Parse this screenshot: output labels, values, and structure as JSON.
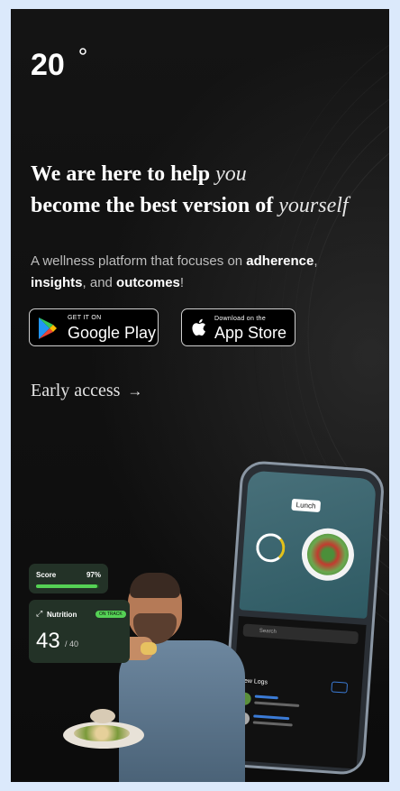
{
  "brand": {
    "logo_text": "20"
  },
  "hero": {
    "line1_bold": "We are here to help ",
    "line1_italic": "you",
    "line2_bold": "become the best version of ",
    "line2_italic": "yourself"
  },
  "subtitle": {
    "part1": "A wellness platform that focuses on ",
    "bold1": "adherence",
    "part2": ", ",
    "bold2": "insights",
    "part3": ", and ",
    "bold3": "outcomes",
    "part4": "!"
  },
  "stores": {
    "google_small": "GET IT ON",
    "google_big": "Google Play",
    "apple_small": "Download on the",
    "apple_big": "App Store"
  },
  "cta": {
    "early_access": "Early access",
    "arrow": "→"
  },
  "phone": {
    "lunch_tag": "Lunch",
    "search_placeholder": "Search",
    "new_logs": "New Logs"
  },
  "score_card": {
    "label": "Score",
    "value": "97%",
    "fill": 0.97
  },
  "nutrition_card": {
    "label": "Nutrition",
    "badge": "ON TRACK",
    "value": "43",
    "denominator": "/ 40"
  },
  "colors": {
    "background": "#101010",
    "accent_green": "#55d155",
    "accent_blue": "#3b7bd6"
  }
}
